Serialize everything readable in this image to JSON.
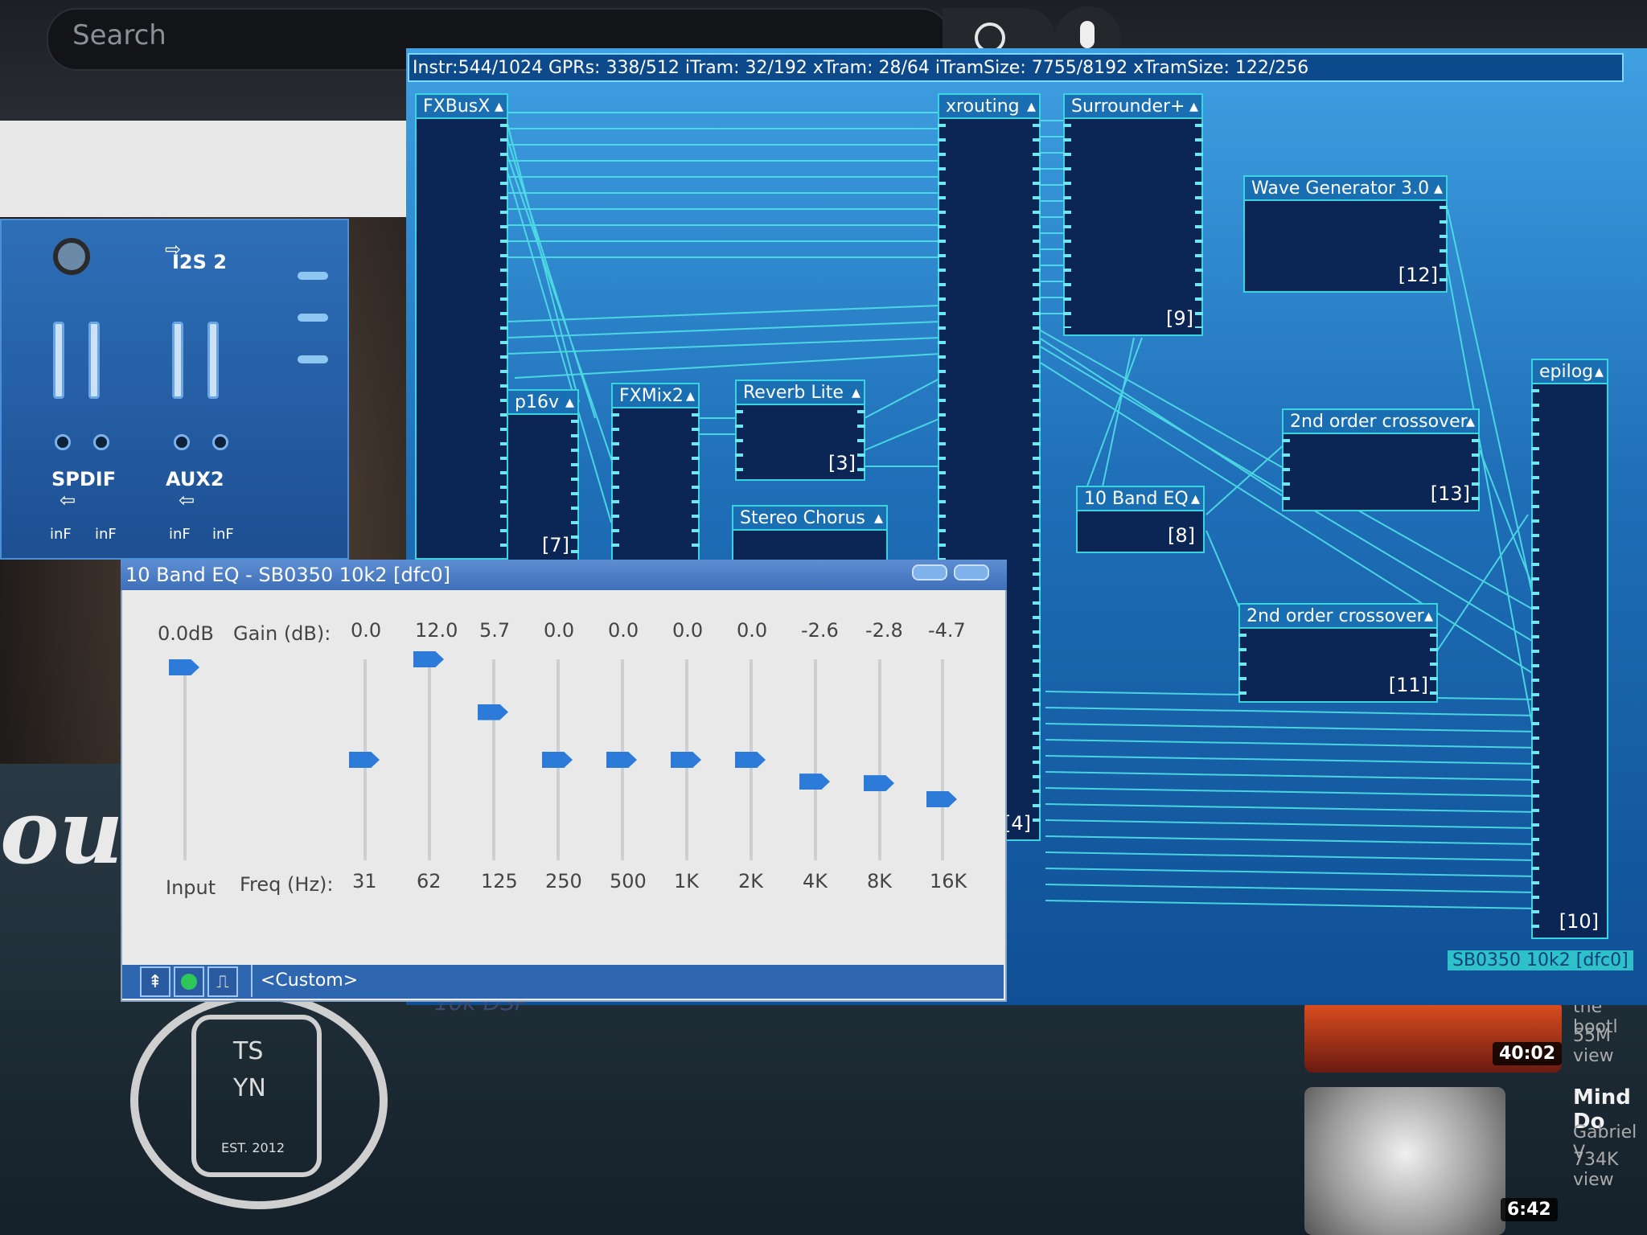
{
  "youtube": {
    "search_placeholder": "Search",
    "videos": [
      {
        "title": "the bootl",
        "stats": "55M view",
        "duration": "40:02"
      },
      {
        "title": "Mind Do",
        "channel": "Gabriel V",
        "stats": "734K view",
        "duration": "6:42"
      }
    ],
    "emblem": {
      "top": "TS",
      "bottom": "YN",
      "est": "EST. 2012"
    },
    "logo_fragment": "ou"
  },
  "mixer": {
    "channels": [
      {
        "name": "SPDIF",
        "db_left": "inF",
        "db_right": "inF"
      },
      {
        "name": "AUX2",
        "db_left": "inF",
        "db_right": "inF"
      }
    ],
    "i2s_label": "I2S 2"
  },
  "dsp": {
    "status": "Instr:544/1024 GPRs: 338/512 iTram: 32/192 xTram: 28/64 iTramSize: 7755/8192 xTramSize: 122/256",
    "footer": "SB0350 10k2 [dfc0]",
    "bottom_caption": "10k DSP",
    "blocks": {
      "fxbusx": {
        "name": "FXBusX"
      },
      "xrouting": {
        "name": "xrouting",
        "num": "[4]"
      },
      "surrounder": {
        "name": "Surrounder+",
        "num": "[9]"
      },
      "wavegen": {
        "name": "Wave Generator 3.0",
        "num": "[12]"
      },
      "epilog": {
        "name": "epilog",
        "num": "[10]"
      },
      "p16v": {
        "name": "p16v",
        "num": "[7]"
      },
      "fxmix2": {
        "name": "FXMix2"
      },
      "reverb": {
        "name": "Reverb Lite",
        "num": "[3]"
      },
      "chorus": {
        "name": "Stereo Chorus"
      },
      "eq10": {
        "name": "10 Band EQ",
        "num": "[8]"
      },
      "cross1": {
        "name": "2nd order crossover",
        "num": "[13]"
      },
      "cross2": {
        "name": "2nd order crossover",
        "num": "[11]"
      }
    }
  },
  "eq": {
    "title": "10 Band EQ - SB0350 10k2 [dfc0]",
    "input_gain": "0.0dB",
    "input_label": "Input",
    "gain_label": "Gain (dB):",
    "freq_label": "Freq (Hz):",
    "bands": [
      {
        "freq": "31",
        "gain": "0.0"
      },
      {
        "freq": "62",
        "gain": "12.0"
      },
      {
        "freq": "125",
        "gain": "5.7"
      },
      {
        "freq": "250",
        "gain": "0.0"
      },
      {
        "freq": "500",
        "gain": "0.0"
      },
      {
        "freq": "1K",
        "gain": "0.0"
      },
      {
        "freq": "2K",
        "gain": "0.0"
      },
      {
        "freq": "4K",
        "gain": "-2.6"
      },
      {
        "freq": "8K",
        "gain": "-2.8"
      },
      {
        "freq": "16K",
        "gain": "-4.7"
      }
    ],
    "preset": "<Custom>"
  }
}
